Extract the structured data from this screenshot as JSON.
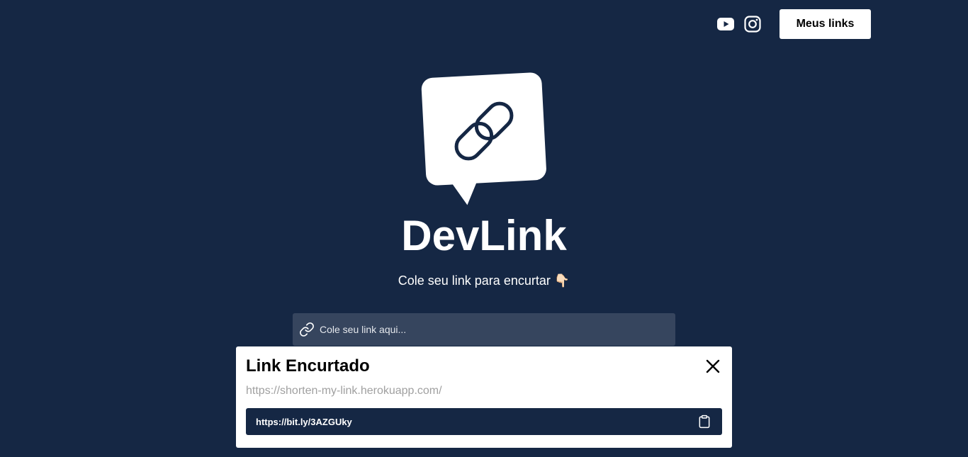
{
  "nav": {
    "youtube_icon": "youtube-icon",
    "instagram_icon": "instagram-icon",
    "my_links_label": "Meus links"
  },
  "hero": {
    "logo_icon": "link-chat-bubble-icon",
    "title": "DevLink",
    "subtitle": "Cole seu link para encurtar 👇🏻"
  },
  "link_input": {
    "icon": "link-icon",
    "placeholder": "Cole seu link aqui...",
    "value": ""
  },
  "modal": {
    "title": "Link Encurtado",
    "original_url": "https://shorten-my-link.herokuapp.com/",
    "short_url": "https://bit.ly/3AZGUky",
    "close_icon": "close-icon",
    "copy_icon": "clipboard-icon"
  },
  "colors": {
    "background": "#152744",
    "input_background": "#36455e",
    "modal_background": "#ffffff",
    "short_link_background": "#152744",
    "muted_text": "#a0a0a0"
  }
}
